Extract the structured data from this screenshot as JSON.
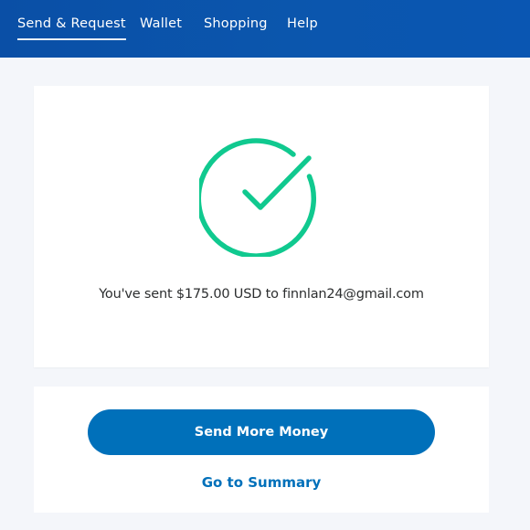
{
  "nav": {
    "items": [
      {
        "label": "Send & Request",
        "active": true
      },
      {
        "label": "Wallet",
        "active": false
      },
      {
        "label": "Shopping",
        "active": false
      },
      {
        "label": "Help",
        "active": false
      }
    ]
  },
  "confirmation": {
    "icon": "check-circle-icon",
    "icon_color": "#10c98f",
    "message": "You've sent $175.00 USD to finnlan24@gmail.com"
  },
  "actions": {
    "primary_label": "Send More Money",
    "secondary_label": "Go to Summary"
  },
  "colors": {
    "header_bg": "#0b55ad",
    "accent": "#0070ba",
    "success": "#10c98f",
    "page_bg": "#f4f6fa"
  }
}
